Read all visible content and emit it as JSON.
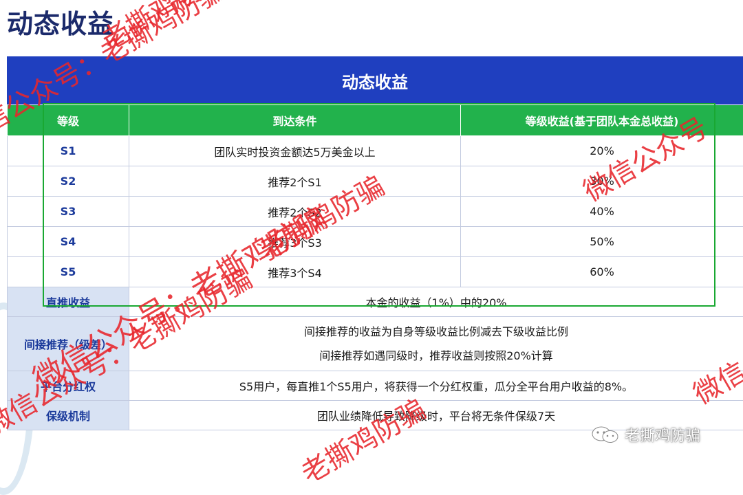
{
  "page_title": "动态收益",
  "table": {
    "banner": "动态收益",
    "headers": [
      "等级",
      "到达条件",
      "等级收益(基于团队本金总收益)"
    ],
    "levels": [
      {
        "level": "S1",
        "condition": "团队实时投资金额达5万美金以上",
        "rate": "20%"
      },
      {
        "level": "S2",
        "condition": "推荐2个S1",
        "rate": "30%"
      },
      {
        "level": "S3",
        "condition": "推荐2个S2",
        "rate": "40%"
      },
      {
        "level": "S4",
        "condition": "推荐3个S3",
        "rate": "50%"
      },
      {
        "level": "S5",
        "condition": "推荐3个S4",
        "rate": "60%"
      }
    ],
    "direct": {
      "label": "直推收益",
      "value": "本金的收益（1%）中的20%"
    },
    "indirect": {
      "label": "间接推荐（级差）",
      "line1": "间接推荐的收益为自身等级收益比例减去下级收益比例",
      "line2": "间接推荐如遇同级时，推荐收益则按照20%计算"
    },
    "dividend": {
      "label": "平台分红权",
      "value": "S5用户，每直推1个S5用户，将获得一个分红权重，瓜分全平台用户收益的8%。"
    },
    "protection": {
      "label": "保级机制",
      "value": "团队业绩降低导致降级时，平台将无条件保级7天"
    }
  },
  "watermarks": [
    "老撕鸡防骗",
    "微信公众号：老撕鸡防骗",
    "微信公众号：老撕鸡防骗",
    "微信公众号",
    "老撕鸡防骗",
    "微信公众号：老撕鸡防骗",
    "老撕鸡防骗",
    "微信"
  ],
  "wechat_badge": {
    "icon": "wechat-icon",
    "label": "老撕鸡防骗"
  },
  "colors": {
    "banner": "#1f3fbf",
    "header": "#22b24c",
    "side": "#d8e2f3",
    "watermark": "#e8262c",
    "highlight_box": "#19a832"
  }
}
